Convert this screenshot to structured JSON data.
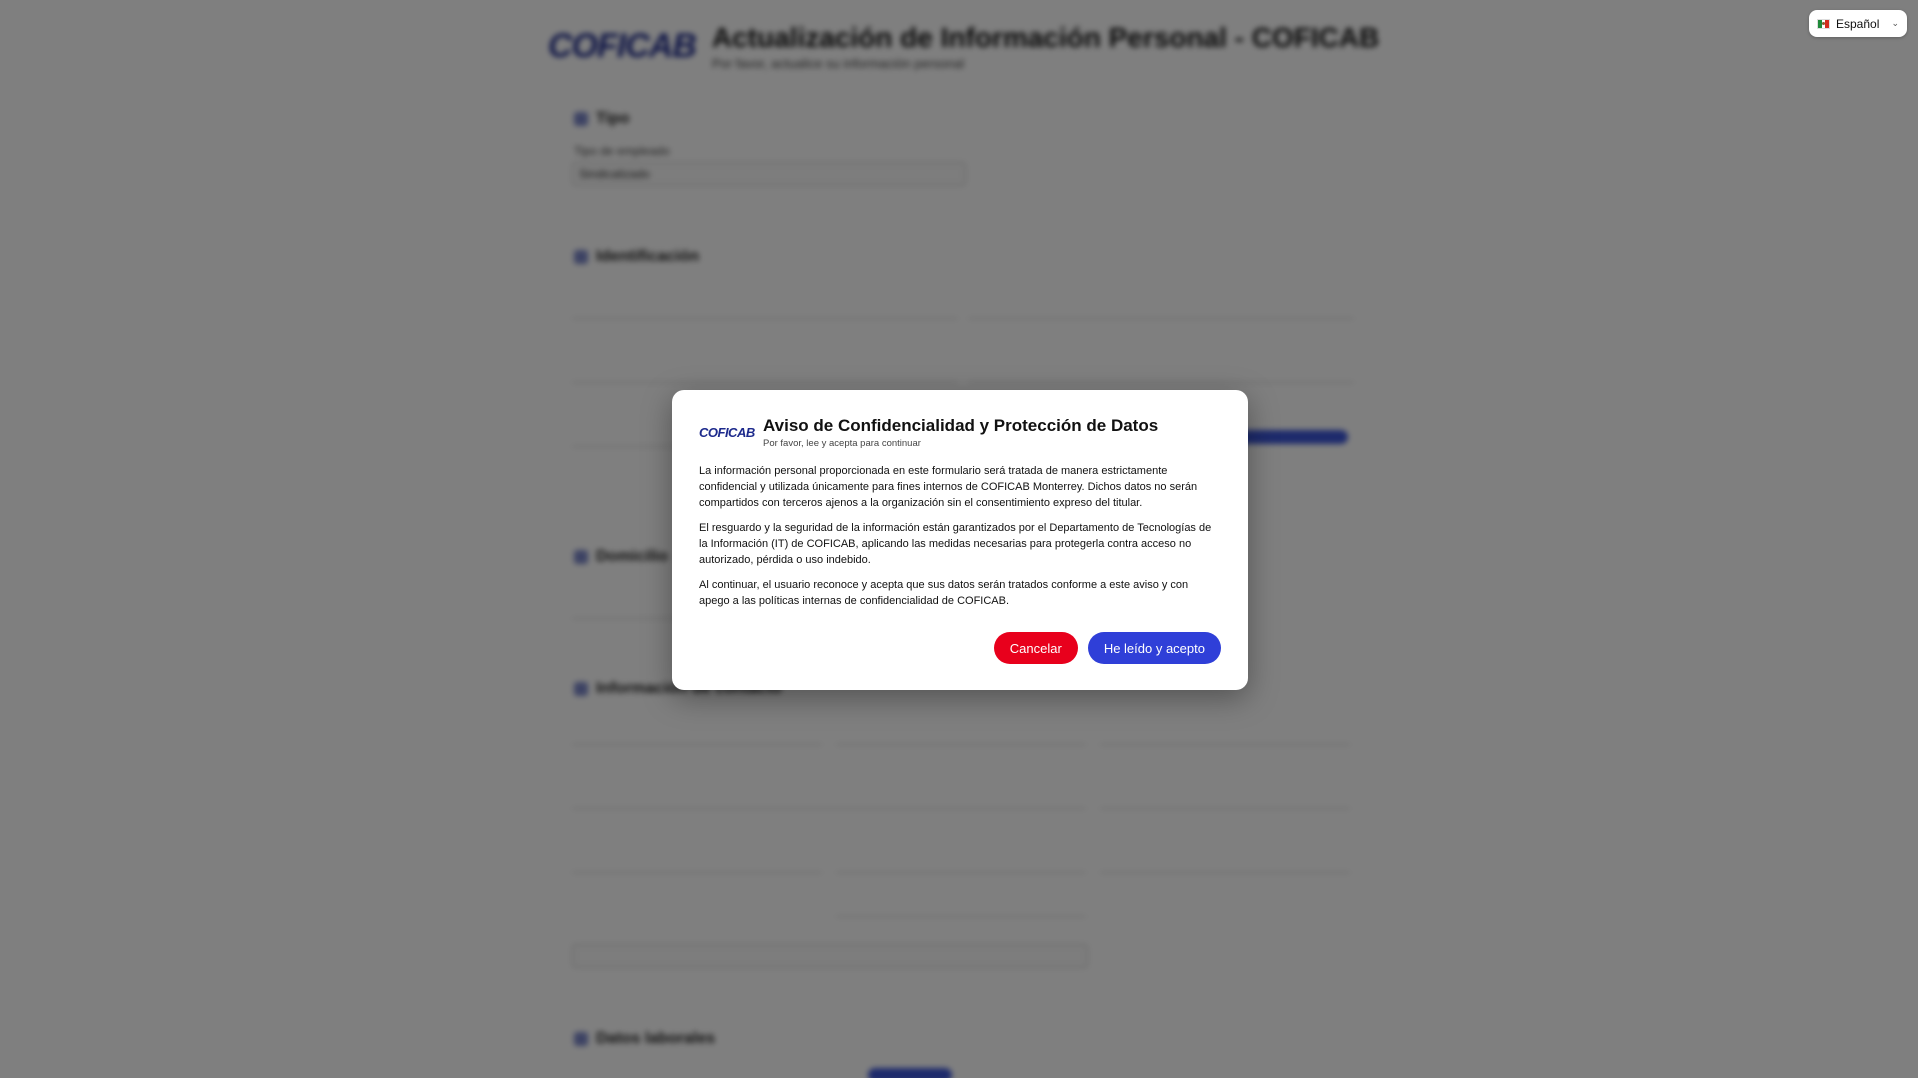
{
  "background": {
    "header": {
      "logo_text": "COFICAB",
      "title": "Actualización de Información Personal - COFICAB",
      "subtitle": "Por favor, actualice su información personal"
    },
    "sections": [
      {
        "title": "Tipo"
      },
      {
        "title": "Identificación"
      },
      {
        "title": "Domicilio"
      },
      {
        "title": "Información de contacto"
      },
      {
        "title": "Datos laborales"
      }
    ],
    "type_field": {
      "label": "Tipo de empleado",
      "value": "Sindicalizado"
    }
  },
  "language": {
    "selected": "Español",
    "flag_icon": "mexico-flag-icon"
  },
  "modal": {
    "logo_text": "COFICAB",
    "title": "Aviso de Confidencialidad y Protección de Datos",
    "subtitle": "Por favor, lee y acepta para continuar",
    "paragraphs": [
      "La información personal proporcionada en este formulario será tratada de manera estrictamente confidencial y utilizada únicamente para fines internos de COFICAB Monterrey. Dichos datos no serán compartidos con terceros ajenos a la organización sin el consentimiento expreso del titular.",
      "El resguardo y la seguridad de la información están garantizados por el Departamento de Tecnologías de la Información (IT) de COFICAB, aplicando las medidas necesarias para protegerla contra acceso no autorizado, pérdida o uso indebido.",
      "Al continuar, el usuario reconoce y acepta que sus datos serán tratados conforme a este aviso y con apego a las políticas internas de confidencialidad de COFICAB."
    ],
    "cancel_label": "Cancelar",
    "accept_label": "He leído y acepto"
  },
  "colors": {
    "overlay": "#000000",
    "cancel": "#e8001c",
    "accept": "#2f3fd8",
    "brand": "#1d2a8c"
  }
}
